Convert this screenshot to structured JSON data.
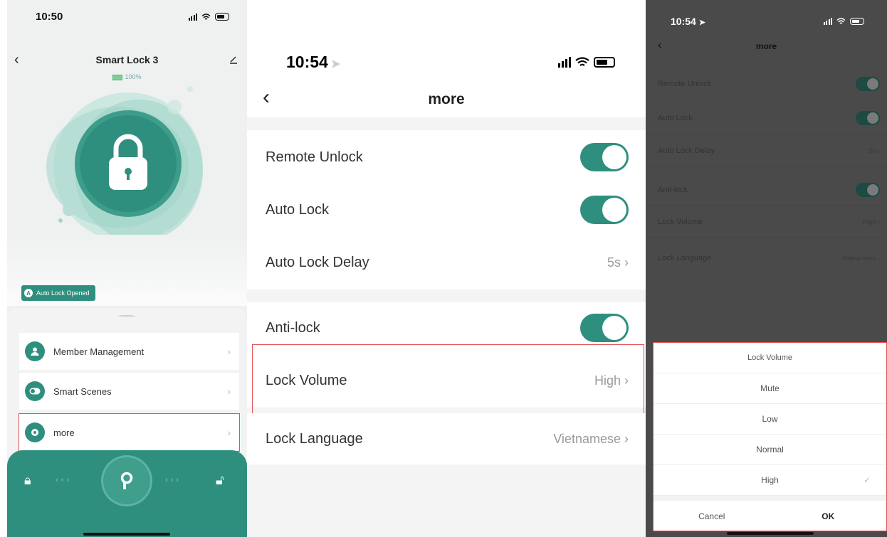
{
  "screen1": {
    "status_time": "10:50",
    "title": "Smart Lock 3",
    "battery_level": "100%",
    "auto_lock_badge": "Auto Lock Opened",
    "menu": [
      {
        "label": "Member Management",
        "icon": "person-icon"
      },
      {
        "label": "Smart Scenes",
        "icon": "toggle-icon"
      },
      {
        "label": "more",
        "icon": "gear-icon"
      }
    ],
    "accent": "#2f8f7e"
  },
  "screen2": {
    "status_time": "10:54",
    "title": "more",
    "rows": [
      {
        "label": "Remote Unlock",
        "toggle": true
      },
      {
        "label": "Auto Lock",
        "toggle": true
      },
      {
        "label": "Auto Lock Delay",
        "value": "5s"
      },
      {
        "label": "Anti-lock",
        "toggle": true
      },
      {
        "label": "Lock Volume",
        "value": "High"
      },
      {
        "label": "Lock Language",
        "value": "Vietnamese"
      }
    ],
    "highlight_color": "#e05252"
  },
  "screen3": {
    "status_time": "10:54",
    "title": "more",
    "rows": [
      {
        "label": "Remote Unlock",
        "toggle": true
      },
      {
        "label": "Auto Lock",
        "toggle": true
      },
      {
        "label": "Auto Lock Delay",
        "value": "5s"
      },
      {
        "label": "Anti-lock",
        "toggle": true
      },
      {
        "label": "Lock Volume",
        "value": "High"
      },
      {
        "label": "Lock Language",
        "value": "Vietnamese"
      }
    ],
    "picker": {
      "title": "Lock Volume",
      "options": [
        "Mute",
        "Low",
        "Normal",
        "High"
      ],
      "selected": "High",
      "cancel": "Cancel",
      "ok": "OK"
    }
  }
}
